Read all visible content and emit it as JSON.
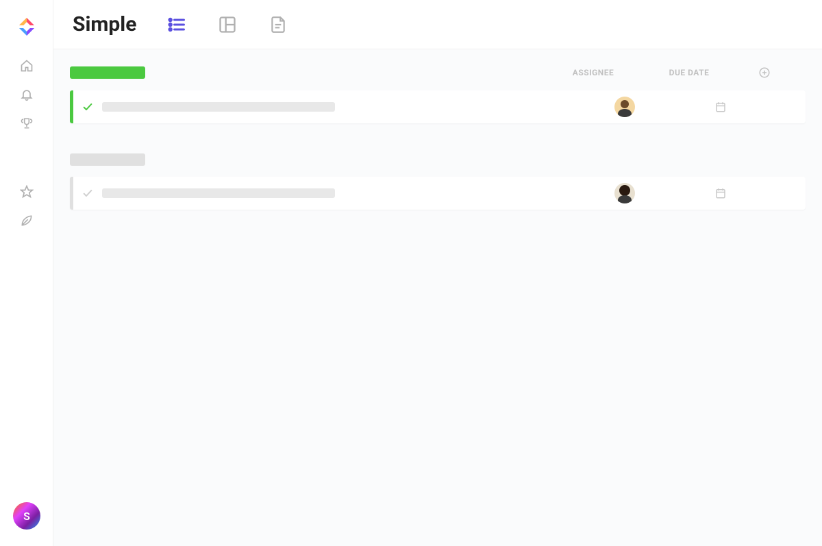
{
  "app": {
    "title": "Simple",
    "user_initial": "S"
  },
  "view_tabs": {
    "list": "list-view",
    "board": "board-view",
    "doc": "doc-view",
    "active": "list-view"
  },
  "sidebar": {
    "items": [
      {
        "name": "home-icon"
      },
      {
        "name": "bell-icon"
      },
      {
        "name": "trophy-icon"
      },
      {
        "name": "star-icon"
      },
      {
        "name": "leaf-icon"
      }
    ]
  },
  "columns": {
    "assignee": "ASSIGNEE",
    "due_date": "DUE DATE"
  },
  "groups": [
    {
      "status_color": "green",
      "tasks": [
        {
          "assignee": "user-1",
          "due_date": ""
        }
      ]
    },
    {
      "status_color": "gray",
      "tasks": [
        {
          "assignee": "user-2",
          "due_date": ""
        }
      ]
    }
  ]
}
